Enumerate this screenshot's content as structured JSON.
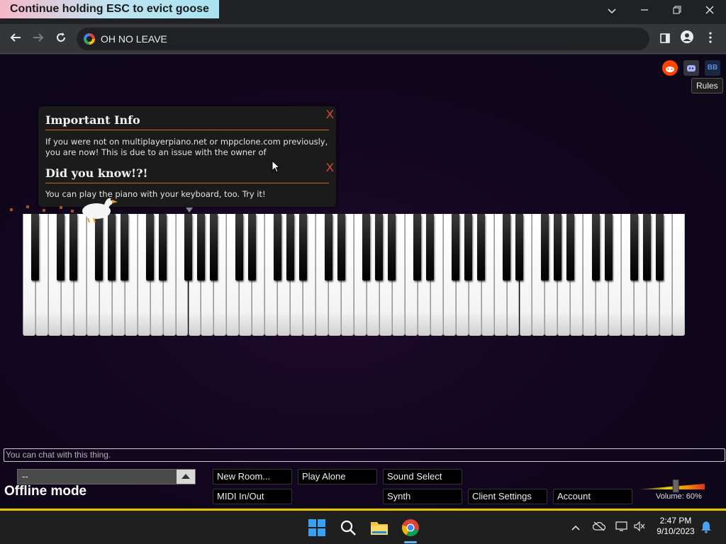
{
  "overlay": {
    "banner_text": "Continue holding ESC to evict goose"
  },
  "browser": {
    "url": "OH NO LEAVE",
    "minimize_icon": "minimize-icon",
    "maximize_icon": "restore-icon",
    "close_icon": "close-icon"
  },
  "header": {
    "social_icons": [
      "reddit-icon",
      "discord-icon",
      "bb-icon"
    ],
    "bb_label": "BB",
    "rules_label": "Rules"
  },
  "notifications": [
    {
      "title": "Important Info",
      "body": "If you were not on multiplayerpiano.net or mppclone.com previously, you are now! This is due to an issue with the owner of",
      "close_label": "X"
    },
    {
      "title": "Did you know!?!",
      "body": "You can play the piano with your keyboard, too. Try it!",
      "close_label": "X"
    }
  ],
  "chat": {
    "placeholder": "You can chat with this thing."
  },
  "room": {
    "selected": "--",
    "status": "Offline mode"
  },
  "buttons": {
    "new_room": "New Room...",
    "play_alone": "Play Alone",
    "sound_select": "Sound Select",
    "midi": "MIDI In/Out",
    "synth": "Synth",
    "client_settings": "Client Settings",
    "account": "Account"
  },
  "volume": {
    "label": "Volume: 60%",
    "level": 0.6
  },
  "taskbar": {
    "time": "2:47 PM",
    "date": "9/10/2023",
    "apps": [
      "windows-start-icon",
      "search-icon",
      "file-explorer-icon",
      "chrome-icon"
    ]
  },
  "colors": {
    "accent_rule": "#d0622c",
    "close_x": "#e04a3a",
    "taskbar_border": "#e6c300"
  }
}
